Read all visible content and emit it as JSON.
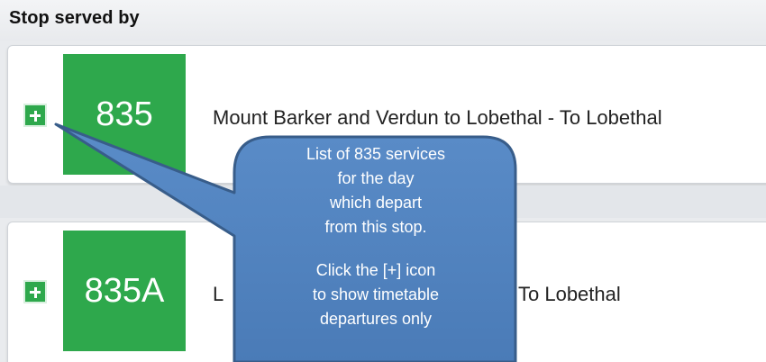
{
  "section": {
    "title": "Stop served by"
  },
  "routes": [
    {
      "number": "835",
      "name": "Mount Barker and Verdun to Lobethal - To Lobethal",
      "color": "#2ea84c"
    },
    {
      "number": "835A",
      "name_left": "L",
      "name_right": "To Lobethal",
      "color": "#2ea84c"
    }
  ],
  "icons": {
    "expand": "plus-icon"
  },
  "tooltip": {
    "line1": "List of 835  services",
    "line2": "for the day",
    "line3": "which depart",
    "line4": "from this stop.",
    "line5": "Click the [+] icon",
    "line6": "to show timetable",
    "line7": "departures only",
    "fill_color": "#4f81bd",
    "border_color": "#385d8a"
  }
}
